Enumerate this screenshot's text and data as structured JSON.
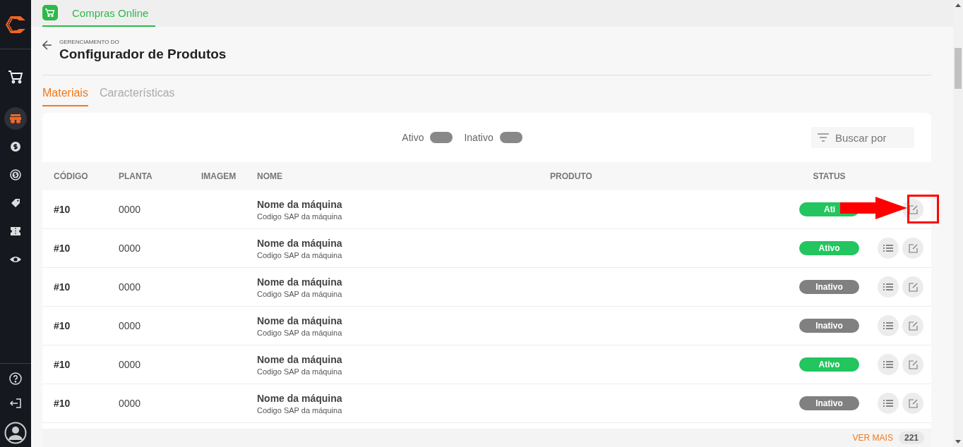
{
  "sidebar": {
    "items": [
      {
        "selected": false
      },
      {
        "selected": true
      },
      {
        "selected": false
      },
      {
        "selected": false
      },
      {
        "selected": false
      },
      {
        "selected": false
      },
      {
        "selected": false
      }
    ]
  },
  "top_tabs": [
    {
      "label": "Compras Online",
      "selected": true
    }
  ],
  "header": {
    "overline": "GERENCIAMENTO DO",
    "title": "Configurador de Produtos"
  },
  "tabs": [
    {
      "label": "Materiais",
      "selected": true
    },
    {
      "label": "Características",
      "selected": false
    }
  ],
  "filters": [
    {
      "label": "Ativo",
      "on": false
    },
    {
      "label": "Inativo",
      "on": false
    }
  ],
  "search": {
    "placeholder": "Buscar por"
  },
  "table": {
    "columns": [
      "CÓDIGO",
      "PLANTA",
      "IMAGEM",
      "NOME",
      "PRODUTO",
      "STATUS"
    ],
    "rows": [
      {
        "code": "#10",
        "plant": "0000",
        "name": "Nome da máquina",
        "sap": "Codigo SAP da máquina",
        "status": "Ati",
        "active": true,
        "highlighted": true
      },
      {
        "code": "#10",
        "plant": "0000",
        "name": "Nome da máquina",
        "sap": "Codigo SAP da máquina",
        "status": "Ativo",
        "active": true,
        "highlighted": false
      },
      {
        "code": "#10",
        "plant": "0000",
        "name": "Nome da máquina",
        "sap": "Codigo SAP da máquina",
        "status": "Inativo",
        "active": false,
        "highlighted": false
      },
      {
        "code": "#10",
        "plant": "0000",
        "name": "Nome da máquina",
        "sap": "Codigo SAP da máquina",
        "status": "Inativo",
        "active": false,
        "highlighted": false
      },
      {
        "code": "#10",
        "plant": "0000",
        "name": "Nome da máquina",
        "sap": "Codigo SAP da máquina",
        "status": "Ativo",
        "active": true,
        "highlighted": false
      },
      {
        "code": "#10",
        "plant": "0000",
        "name": "Nome da máquina",
        "sap": "Codigo SAP da máquina",
        "status": "Inativo",
        "active": false,
        "highlighted": false
      }
    ]
  },
  "footer": {
    "link": "VER MAIS",
    "count": "221"
  }
}
